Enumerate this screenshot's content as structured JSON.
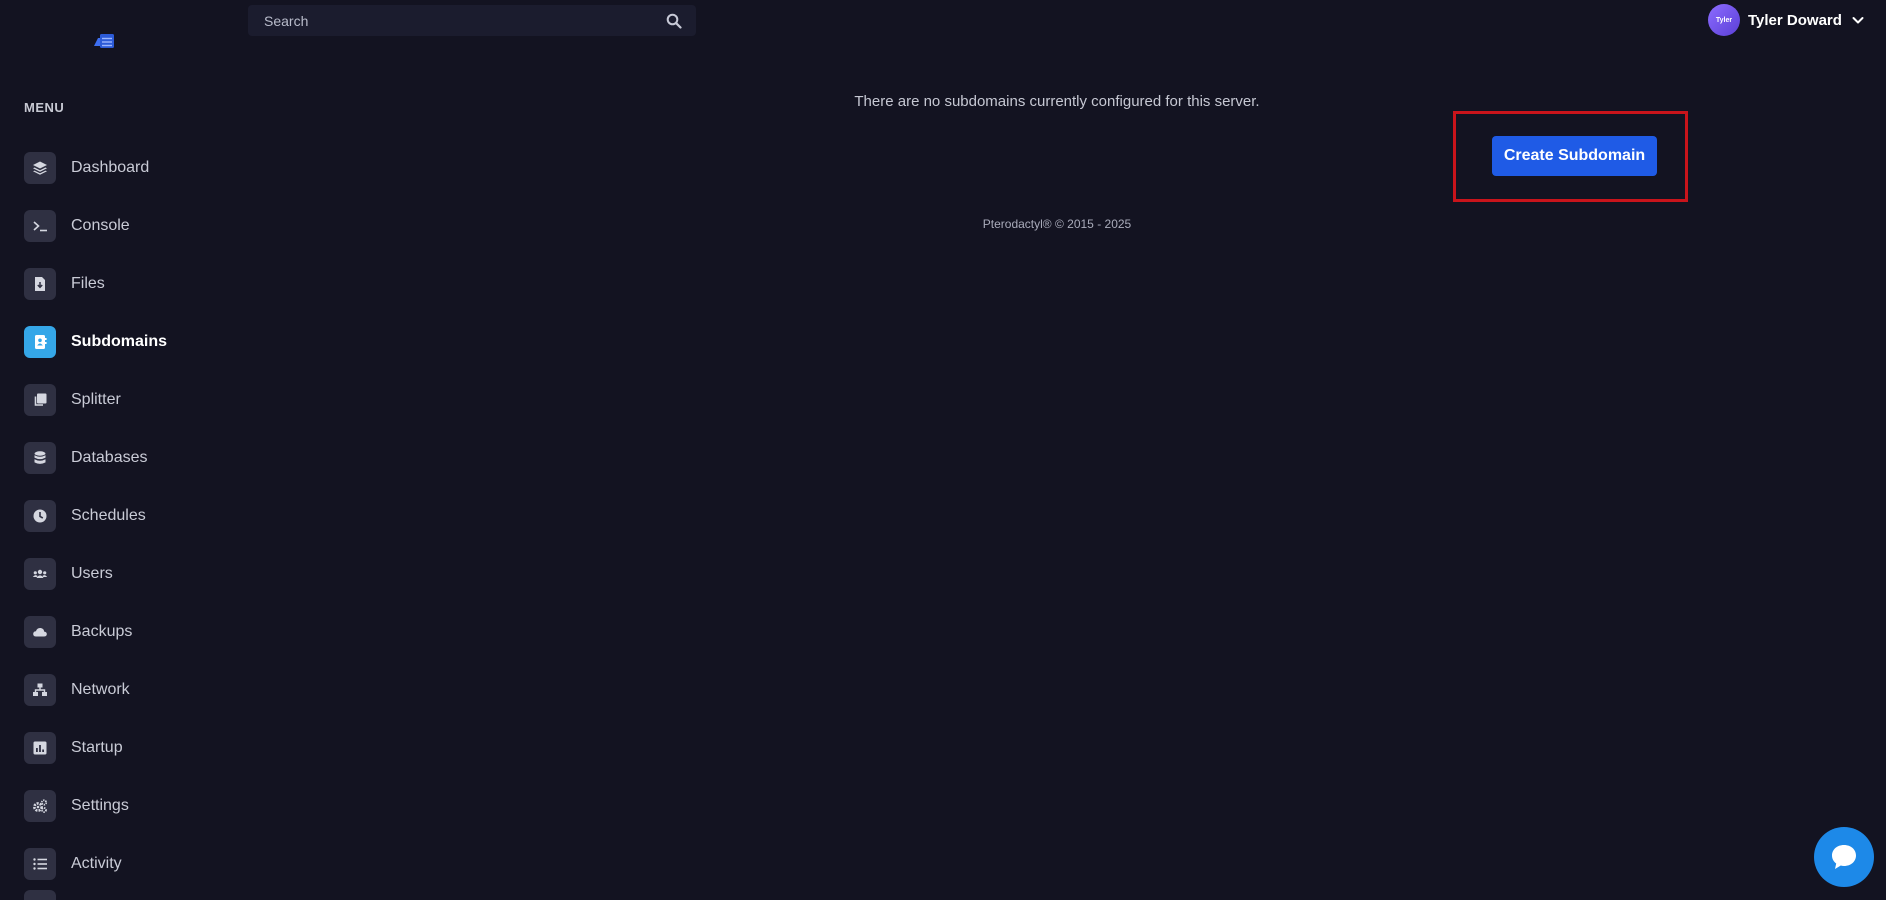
{
  "logo": {
    "icon": "server-logo-icon"
  },
  "search": {
    "placeholder": "Search",
    "icon": "search-icon"
  },
  "user": {
    "avatar_text": "Tyler",
    "name": "Tyler Doward",
    "icon": "chevron-down-icon"
  },
  "sidebar": {
    "heading": "MENU",
    "active_color": "#35a7e8",
    "items": [
      {
        "label": "Dashboard",
        "icon": "layers-icon"
      },
      {
        "label": "Console",
        "icon": "terminal-icon"
      },
      {
        "label": "Files",
        "icon": "file-download-icon"
      },
      {
        "label": "Subdomains",
        "icon": "address-book-icon",
        "active": true
      },
      {
        "label": "Splitter",
        "icon": "copy-icon"
      },
      {
        "label": "Databases",
        "icon": "database-icon"
      },
      {
        "label": "Schedules",
        "icon": "clock-icon"
      },
      {
        "label": "Users",
        "icon": "users-icon"
      },
      {
        "label": "Backups",
        "icon": "cloud-icon"
      },
      {
        "label": "Network",
        "icon": "network-icon"
      },
      {
        "label": "Startup",
        "icon": "chart-icon"
      },
      {
        "label": "Settings",
        "icon": "cogs-icon"
      },
      {
        "label": "Activity",
        "icon": "list-icon"
      }
    ]
  },
  "main": {
    "empty_message": "There are no subdomains currently configured for this server.",
    "create_button": "Create Subdomain",
    "button_color": "#1f5be6",
    "highlight_color": "#c9141b"
  },
  "footer": {
    "text": "Pterodactyl® © 2015 - 2025"
  },
  "chat": {
    "icon": "chat-bubble-icon",
    "color": "#1d89e8"
  }
}
